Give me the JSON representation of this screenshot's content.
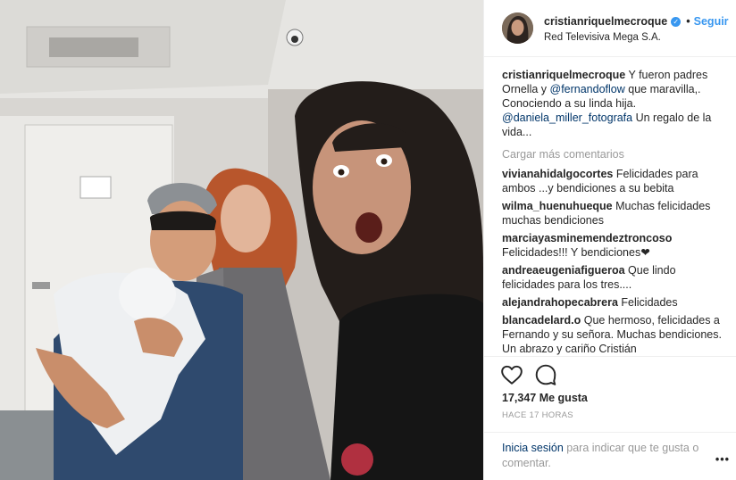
{
  "header": {
    "username": "cristianriquelmecroque",
    "verified_icon": "check",
    "separator": "•",
    "follow_label": "Seguir",
    "location": "Red Televisiva Mega S.A."
  },
  "caption": {
    "username": "cristianriquelmecroque",
    "text_1": " Y fueron padres Ornella y ",
    "mention_1": "@fernandoflow",
    "text_2": " que maravilla,. Conociendo a su linda hija. ",
    "mention_2": "@daniela_miller_fotografa",
    "text_3": " Un regalo de la vida..."
  },
  "load_more": "Cargar más comentarios",
  "comments": [
    {
      "user": "vivianahidalgocortes",
      "text": "Felicidades para ambos ...y bendiciones a su bebita"
    },
    {
      "user": "wilma_huenuhueque",
      "text": "Muchas felicidades muchas bendiciones"
    },
    {
      "user": "marciayasminemendeztroncoso",
      "text": "Felicidades!!! Y bendiciones❤"
    },
    {
      "user": "andreaeugeniafigueroa",
      "text": "Que lindo felicidades para los tres...."
    },
    {
      "user": "alejandrahopecabrera",
      "text": "Felicidades"
    },
    {
      "user": "blancadelard.o",
      "text": "Que hermoso, felicidades a Fernando y su señora. Muchas bendiciones. Un abrazo y cariño Cristián"
    }
  ],
  "icons": {
    "like": "heart-icon",
    "comment": "comment-icon",
    "more": "more-options-icon"
  },
  "likes": "17,347 Me gusta",
  "time": "HACE 17 HORAS",
  "login": {
    "link": "Inicia sesión",
    "text": " para indicar que te gusta o comentar."
  },
  "more_label": "•••",
  "colors": {
    "accent": "#3897f0",
    "mention": "#003569",
    "muted": "#999999",
    "text": "#262626"
  }
}
